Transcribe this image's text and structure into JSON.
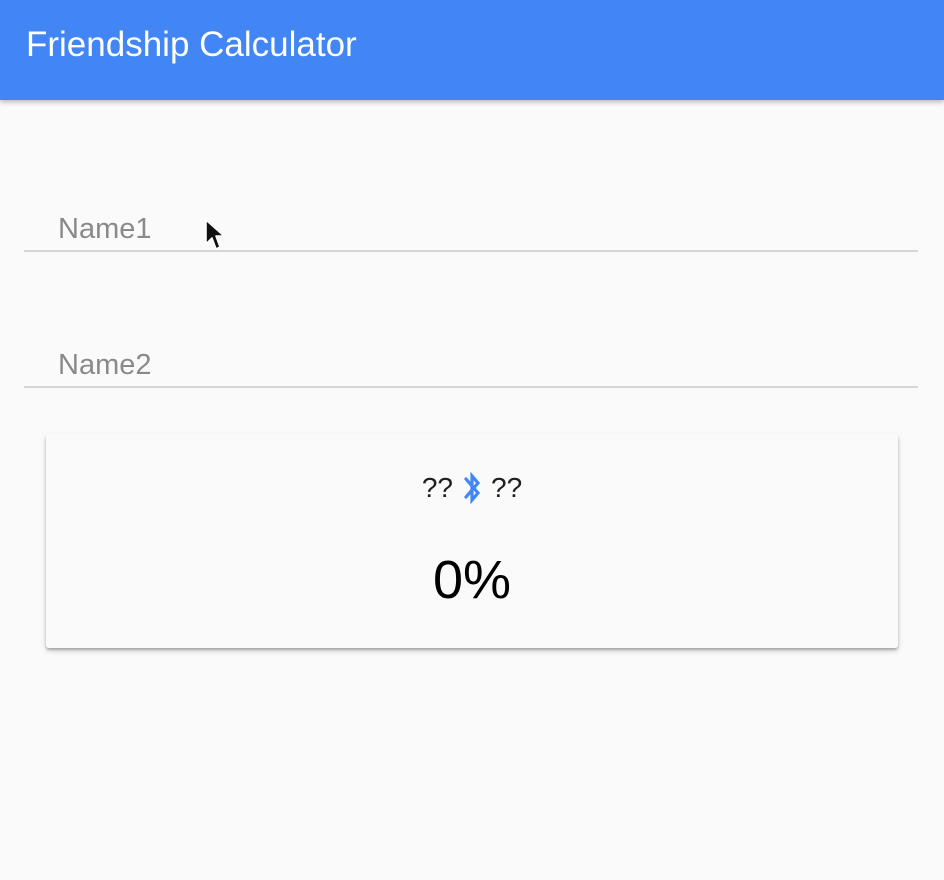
{
  "app_bar": {
    "title": "Friendship Calculator",
    "color": "#4285f4"
  },
  "form": {
    "name1": {
      "placeholder": "Name1",
      "value": ""
    },
    "name2": {
      "placeholder": "Name2",
      "value": ""
    }
  },
  "result_card": {
    "name1_display": "??",
    "name2_display": "??",
    "link_icon": "bluetooth-icon",
    "link_icon_color": "#4285f4",
    "percentage": "0%"
  }
}
